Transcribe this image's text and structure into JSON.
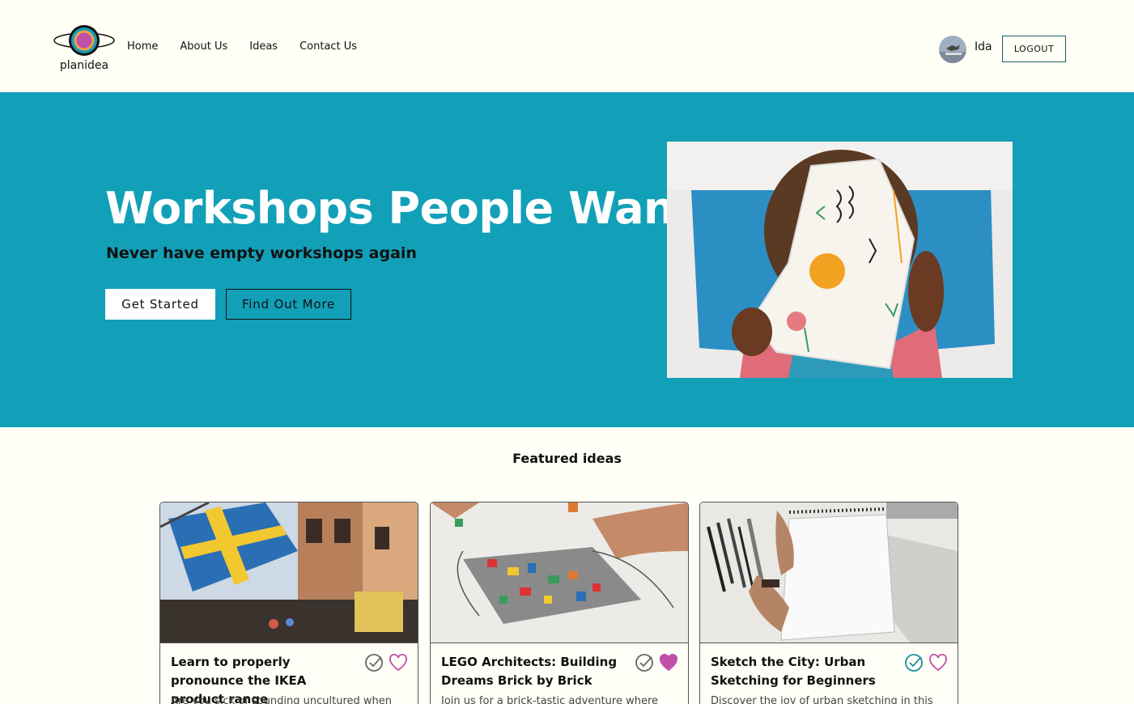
{
  "header": {
    "logo_text": "planidea",
    "nav": [
      {
        "label": "Home"
      },
      {
        "label": "About Us"
      },
      {
        "label": "Ideas"
      },
      {
        "label": "Contact Us"
      }
    ],
    "user": {
      "name": "Ida"
    },
    "logout_label": "LOGOUT"
  },
  "hero": {
    "title": "Workshops People Want",
    "subtitle": "Never have empty workshops again",
    "primary_button": "Get Started",
    "secondary_button": "Find Out More"
  },
  "featured": {
    "heading": "Featured ideas",
    "cards": [
      {
        "title": "Learn to properly pronounce the IKEA product range",
        "description": "Are you sick of sounding uncultured when",
        "checked": false,
        "liked": false
      },
      {
        "title": "LEGO Architects: Building Dreams Brick by Brick",
        "description": "Join us for a brick-tastic adventure where",
        "checked": false,
        "liked": true
      },
      {
        "title": "Sketch the City: Urban Sketching for Beginners",
        "description": "Discover the joy of urban sketching in this",
        "checked": true,
        "liked": false
      }
    ]
  },
  "colors": {
    "hero_bg": "#11a0b8",
    "accent_teal": "#1a8fa0",
    "heart_pink": "#c050a8",
    "page_bg": "#fffff8"
  },
  "icons": [
    "logo-planet-icon",
    "check-circle-icon",
    "heart-icon"
  ]
}
